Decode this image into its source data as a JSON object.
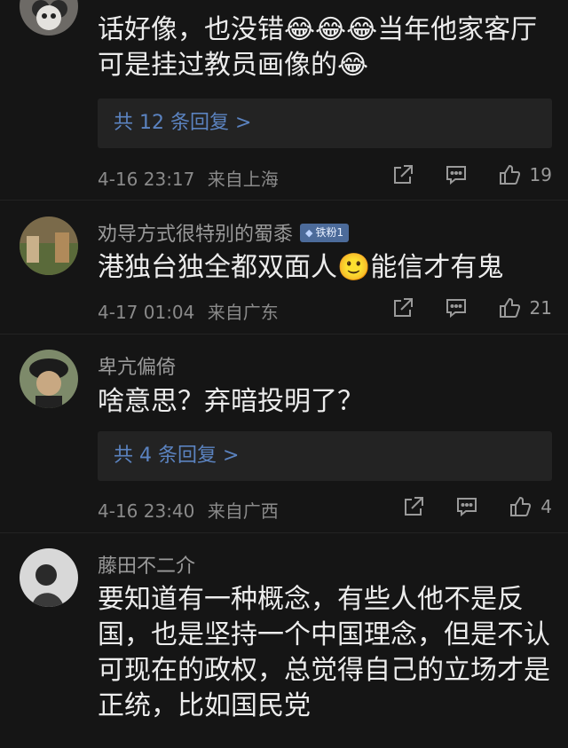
{
  "comments": [
    {
      "name": "",
      "text": "话好像，也没错😂😂😂当年他家客厅可是挂过教员画像的😂",
      "replies": "共 12 条回复 >",
      "time": "4-16 23:17",
      "location": "来自上海",
      "likes": "19"
    },
    {
      "name": "劝导方式很特别的蜀黍",
      "badge": "铁粉1",
      "text": "港独台独全都双面人🙂能信才有鬼",
      "time": "4-17 01:04",
      "location": "来自广东",
      "likes": "21"
    },
    {
      "name": "卑亢偏倚",
      "text": "啥意思？弃暗投明了？",
      "replies": "共 4 条回复 >",
      "time": "4-16 23:40",
      "location": "来自广西",
      "likes": "4"
    },
    {
      "name": "藤田不二介",
      "text": "要知道有一种概念，有些人他不是反国，也是坚持一个中国理念，但是不认可现在的政权，总觉得自己的立场才是正统，比如国民党"
    }
  ],
  "icons": {
    "share": "share-icon",
    "comment": "comment-icon",
    "like": "thumbs-up-icon"
  },
  "colors": {
    "background": "#151515",
    "link": "#5b83c0",
    "badge": "#4c6b9a"
  }
}
